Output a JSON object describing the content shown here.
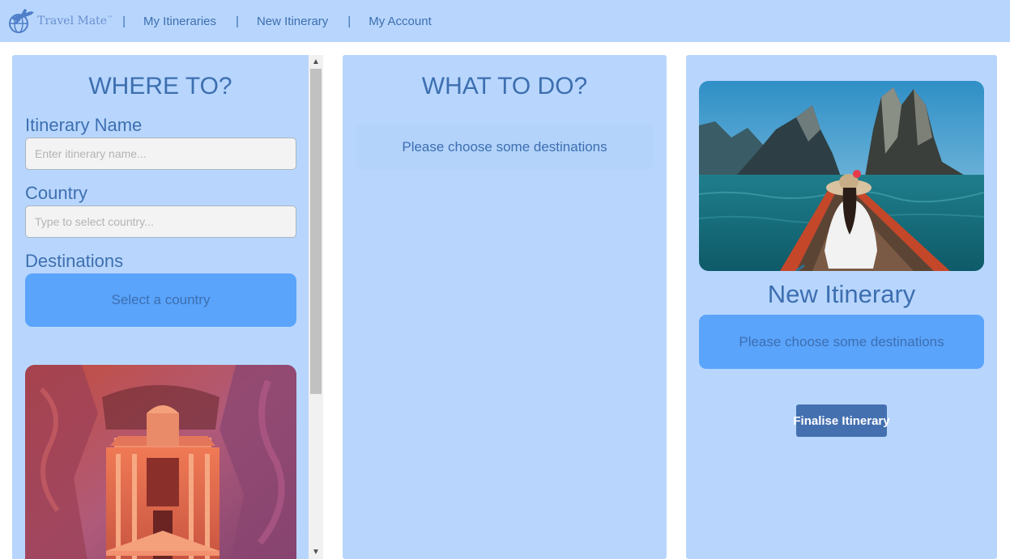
{
  "nav": {
    "brand_name": "Travel Mate",
    "brand_tm": "™",
    "separator": "|",
    "links": [
      "My Itineraries",
      "New Itinerary",
      "My Account"
    ]
  },
  "where": {
    "title": "WHERE TO?",
    "itinerary_label": "Itinerary Name",
    "itinerary_placeholder": "Enter itinerary name...",
    "country_label": "Country",
    "country_placeholder": "Type to select country...",
    "destinations_label": "Destinations",
    "select_country_text": "Select a country"
  },
  "what": {
    "title": "WHAT TO DO?",
    "empty_text": "Please choose some destinations"
  },
  "itinerary": {
    "title": "New Itinerary",
    "empty_text": "Please choose some destinations",
    "finalise_label": "Finalise Itinerary"
  },
  "colors": {
    "panel_bg": "#b8d6fd",
    "accent_text": "#3d6fb0",
    "button_blue": "#5aa4fc",
    "finalise_btn": "#4470b0"
  },
  "icons": [
    "plane-globe-logo-icon",
    "scroll-up-icon",
    "scroll-down-icon"
  ]
}
